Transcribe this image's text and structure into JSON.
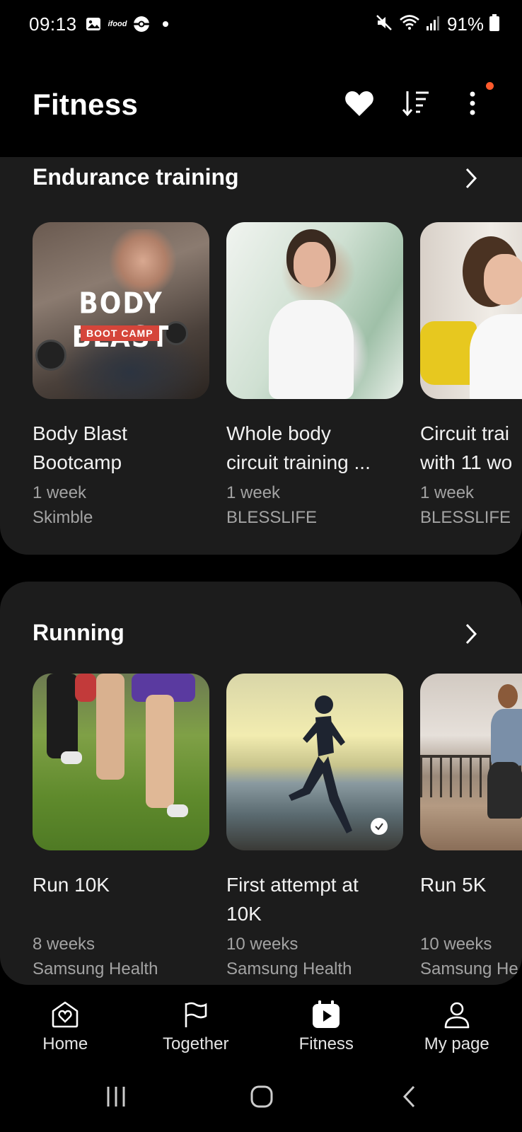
{
  "status_bar": {
    "time": "09:13",
    "notification_icons": [
      "image-icon",
      "app-icon",
      "pokeball-icon",
      "dot-icon"
    ],
    "small_app_text": "ifood",
    "battery_text": "91%"
  },
  "header": {
    "title": "Fitness"
  },
  "sections": [
    {
      "title": "Endurance training",
      "items": [
        {
          "title_line1": "Body Blast",
          "title_line2": "Bootcamp",
          "duration": "1 week",
          "provider": "Skimble",
          "thumb_text": "BODY BLAST",
          "thumb_tag": "BOOT CAMP"
        },
        {
          "title_line1": "Whole body",
          "title_line2": "circuit training ...",
          "duration": "1 week",
          "provider": "BLESSLIFE"
        },
        {
          "title_line1": "Circuit trai",
          "title_line2": "with 11 wo",
          "duration": "1 week",
          "provider": "BLESSLIFE"
        }
      ]
    },
    {
      "title": "Running",
      "items": [
        {
          "title_line1": "Run 10K",
          "title_line2": "",
          "duration": "8 weeks",
          "provider": "Samsung Health"
        },
        {
          "title_line1": "First attempt at",
          "title_line2": "10K",
          "duration": "10 weeks",
          "provider": "Samsung Health"
        },
        {
          "title_line1": "Run 5K",
          "title_line2": "",
          "duration": "10 weeks",
          "provider": "Samsung He"
        }
      ]
    }
  ],
  "bottom_nav": [
    {
      "label": "Home",
      "icon": "home-heart-icon"
    },
    {
      "label": "Together",
      "icon": "flag-icon"
    },
    {
      "label": "Fitness",
      "icon": "fitness-play-icon",
      "active": true
    },
    {
      "label": "My page",
      "icon": "person-icon"
    }
  ],
  "colors": {
    "background": "#000000",
    "card": "#1c1c1c",
    "secondary_text": "#a3a3a3",
    "notification_dot": "#ff5a2c"
  }
}
